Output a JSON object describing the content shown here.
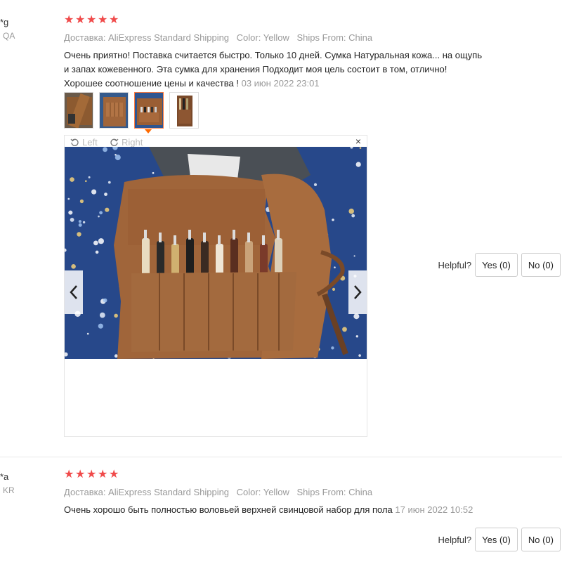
{
  "reviews": [
    {
      "user": "*g",
      "country": "QA",
      "rating": 5,
      "meta": {
        "shipping": "Доставка: AliExpress Standard Shipping",
        "color": "Color: Yellow",
        "ships_from": "Ships From: China"
      },
      "text": "Очень приятно! Поставка считается быстро. Только 10 дней. Сумка Натуральная кожа... на ощупь и запах кожевенного. Эта сумка для хранения Подходит моя цель состоит в том, отлично! Хорошее соотношение цены и качества !",
      "date": "03 июн 2022 23:01",
      "viewer": {
        "rotate_left": "Left",
        "rotate_right": "Right",
        "close": "×"
      },
      "helpful": {
        "label": "Helpful?",
        "yes": "Yes (0)",
        "no": "No (0)"
      }
    },
    {
      "user": "*a",
      "country": "KR",
      "rating": 5,
      "meta": {
        "shipping": "Доставка: AliExpress Standard Shipping",
        "color": "Color: Yellow",
        "ships_from": "Ships From: China"
      },
      "text": "Очень хорошо быть полностью воловьей верхней свинцовой набор для пола",
      "date": "17 июн 2022 10:52",
      "helpful": {
        "label": "Helpful?",
        "yes": "Yes (0)",
        "no": "No (0)"
      }
    }
  ],
  "icons": {
    "star": "star-icon",
    "rotate_left": "rotate-left-icon",
    "rotate_right": "rotate-right-icon",
    "prev": "chevron-left-icon",
    "next": "chevron-right-icon"
  },
  "colors": {
    "star": "#f04a4a",
    "active_thumb": "#ff7a3d",
    "muted_text": "#999999"
  }
}
